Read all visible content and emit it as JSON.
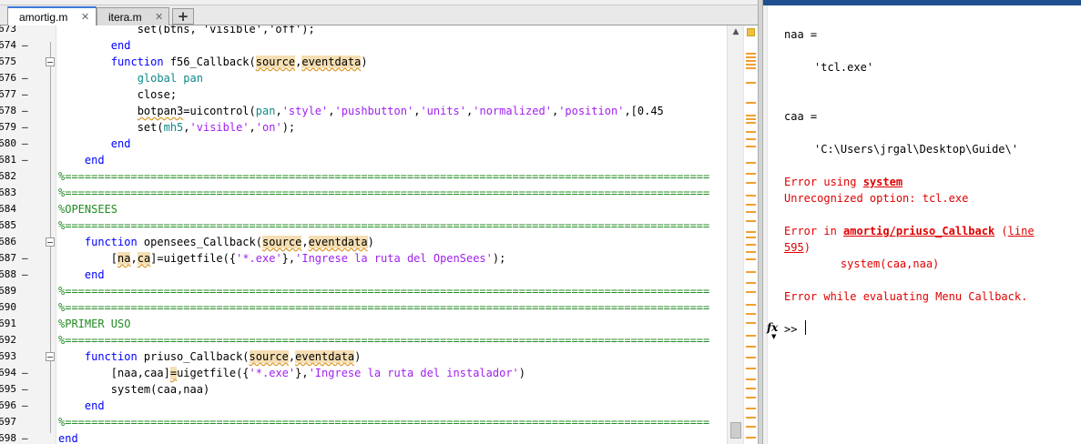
{
  "window": {
    "top_strip_text": "...  ...  ...  ...  ...  ..."
  },
  "tabs": [
    {
      "label": "amortig.m",
      "close": "✕"
    },
    {
      "label": "itera.m",
      "close": "✕"
    }
  ],
  "tab_add_label": "+",
  "editor": {
    "lines": [
      {
        "num": "673",
        "dash": "",
        "segs": [
          {
            "t": "            set(btns, 'visible','off');",
            "c": ""
          }
        ]
      },
      {
        "num": "674",
        "dash": "—",
        "segs": [
          {
            "t": "        end",
            "c": "kw"
          }
        ]
      },
      {
        "num": "675",
        "dash": "",
        "segs": [
          {
            "t": "        function",
            "c": "kw"
          },
          {
            "t": " f56_Callback(",
            "c": ""
          },
          {
            "t": "source",
            "c": "hl"
          },
          {
            "t": ",",
            "c": ""
          },
          {
            "t": "eventdata",
            "c": "hl"
          },
          {
            "t": ")",
            "c": ""
          }
        ]
      },
      {
        "num": "676",
        "dash": "—",
        "segs": [
          {
            "t": "            ",
            "c": ""
          },
          {
            "t": "global pan",
            "c": "gl"
          }
        ]
      },
      {
        "num": "677",
        "dash": "—",
        "segs": [
          {
            "t": "            close;",
            "c": ""
          }
        ]
      },
      {
        "num": "678",
        "dash": "—",
        "segs": [
          {
            "t": "            ",
            "c": ""
          },
          {
            "t": "botpan3",
            "c": "wv"
          },
          {
            "t": "=uicontrol(",
            "c": ""
          },
          {
            "t": "pan",
            "c": "gl"
          },
          {
            "t": ",",
            "c": ""
          },
          {
            "t": "'style'",
            "c": "str"
          },
          {
            "t": ",",
            "c": ""
          },
          {
            "t": "'pushbutton'",
            "c": "str"
          },
          {
            "t": ",",
            "c": ""
          },
          {
            "t": "'units'",
            "c": "str"
          },
          {
            "t": ",",
            "c": ""
          },
          {
            "t": "'normalized'",
            "c": "str"
          },
          {
            "t": ",",
            "c": ""
          },
          {
            "t": "'position'",
            "c": "str"
          },
          {
            "t": ",[0.45",
            "c": ""
          }
        ]
      },
      {
        "num": "679",
        "dash": "—",
        "segs": [
          {
            "t": "            set(",
            "c": ""
          },
          {
            "t": "mh5",
            "c": "gl"
          },
          {
            "t": ",",
            "c": ""
          },
          {
            "t": "'visible'",
            "c": "str"
          },
          {
            "t": ",",
            "c": ""
          },
          {
            "t": "'on'",
            "c": "str"
          },
          {
            "t": ");",
            "c": ""
          }
        ]
      },
      {
        "num": "680",
        "dash": "—",
        "segs": [
          {
            "t": "        end",
            "c": "kw"
          }
        ]
      },
      {
        "num": "681",
        "dash": "—",
        "segs": [
          {
            "t": "    end",
            "c": "kw"
          }
        ]
      },
      {
        "num": "682",
        "dash": "",
        "segs": [
          {
            "t": "%==================================================================================================",
            "c": "cm"
          }
        ]
      },
      {
        "num": "683",
        "dash": "",
        "segs": [
          {
            "t": "%==================================================================================================",
            "c": "cm"
          }
        ]
      },
      {
        "num": "684",
        "dash": "",
        "segs": [
          {
            "t": "%OPENSEES",
            "c": "cm"
          }
        ]
      },
      {
        "num": "685",
        "dash": "",
        "segs": [
          {
            "t": "%==================================================================================================",
            "c": "cm"
          }
        ]
      },
      {
        "num": "686",
        "dash": "",
        "segs": [
          {
            "t": "    function",
            "c": "kw"
          },
          {
            "t": " opensees_Callback(",
            "c": ""
          },
          {
            "t": "source",
            "c": "hl"
          },
          {
            "t": ",",
            "c": ""
          },
          {
            "t": "eventdata",
            "c": "hl"
          },
          {
            "t": ")",
            "c": ""
          }
        ]
      },
      {
        "num": "687",
        "dash": "—",
        "segs": [
          {
            "t": "        [",
            "c": ""
          },
          {
            "t": "na",
            "c": "hl"
          },
          {
            "t": ",",
            "c": ""
          },
          {
            "t": "ca",
            "c": "hl"
          },
          {
            "t": "]=uigetfile({",
            "c": ""
          },
          {
            "t": "'*.exe'",
            "c": "str"
          },
          {
            "t": "},",
            "c": ""
          },
          {
            "t": "'Ingrese la ruta del OpenSees'",
            "c": "str"
          },
          {
            "t": ");",
            "c": ""
          }
        ]
      },
      {
        "num": "688",
        "dash": "—",
        "segs": [
          {
            "t": "    end",
            "c": "kw"
          }
        ]
      },
      {
        "num": "689",
        "dash": "",
        "segs": [
          {
            "t": "%==================================================================================================",
            "c": "cm"
          }
        ]
      },
      {
        "num": "690",
        "dash": "",
        "segs": [
          {
            "t": "%==================================================================================================",
            "c": "cm"
          }
        ]
      },
      {
        "num": "691",
        "dash": "",
        "segs": [
          {
            "t": "%PRIMER USO",
            "c": "cm"
          }
        ]
      },
      {
        "num": "692",
        "dash": "",
        "segs": [
          {
            "t": "%==================================================================================================",
            "c": "cm"
          }
        ]
      },
      {
        "num": "693",
        "dash": "",
        "segs": [
          {
            "t": "    function",
            "c": "kw"
          },
          {
            "t": " priuso_Callback(",
            "c": ""
          },
          {
            "t": "source",
            "c": "hl"
          },
          {
            "t": ",",
            "c": ""
          },
          {
            "t": "eventdata",
            "c": "hl"
          },
          {
            "t": ")",
            "c": ""
          }
        ]
      },
      {
        "num": "694",
        "dash": "—",
        "segs": [
          {
            "t": "        [naa,caa]",
            "c": ""
          },
          {
            "t": "=",
            "c": "hl"
          },
          {
            "t": "uigetfile({",
            "c": ""
          },
          {
            "t": "'*.exe'",
            "c": "str"
          },
          {
            "t": "},",
            "c": ""
          },
          {
            "t": "'Ingrese la ruta del instalador'",
            "c": "str"
          },
          {
            "t": ")",
            "c": ""
          }
        ]
      },
      {
        "num": "695",
        "dash": "—",
        "segs": [
          {
            "t": "        system(caa,naa)",
            "c": ""
          }
        ]
      },
      {
        "num": "696",
        "dash": "—",
        "segs": [
          {
            "t": "    end",
            "c": "kw"
          }
        ]
      },
      {
        "num": "697",
        "dash": "",
        "segs": [
          {
            "t": "%==================================================================================================",
            "c": "cm"
          }
        ]
      },
      {
        "num": "698",
        "dash": "—",
        "segs": [
          {
            "t": "end",
            "c": "kw"
          }
        ]
      }
    ]
  },
  "command_window": {
    "naa_label": "naa =",
    "naa_value": "'tcl.exe'",
    "caa_label": "caa =",
    "caa_value": "'C:\\Users\\jrgal\\Desktop\\Guide\\'",
    "err1_prefix": "Error using ",
    "err1_func": "system",
    "err1_msg": "Unrecognized option: tcl.exe",
    "err2_prefix": "Error in ",
    "err2_func": "amortig/priuso_Callback",
    "err2_open": " (",
    "err2_line_word": "line",
    "err2_line_num": "595",
    "err2_close": ")",
    "err2_code": "    system(caa,naa)",
    "err3": "Error while evaluating Menu Callback.",
    "fx_icon": "fx",
    "prompt": ">>"
  }
}
